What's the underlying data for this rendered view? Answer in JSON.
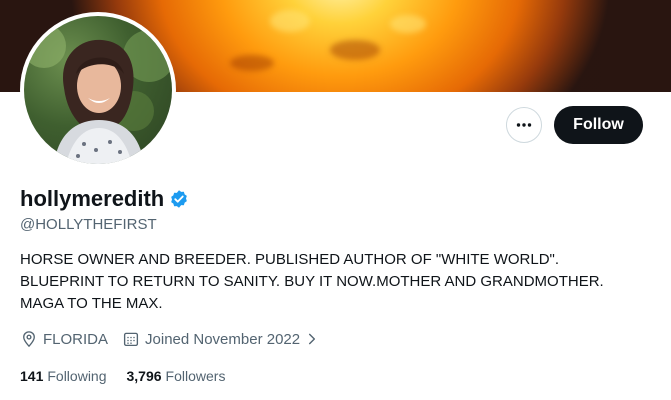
{
  "profile": {
    "display_name": "hollymeredith",
    "handle": "@HOLLYTHEFIRST",
    "verified": true,
    "bio_lines": [
      "HORSE OWNER AND BREEDER. PUBLISHED AUTHOR OF \"WHITE WORLD\".",
      "BLUEPRINT TO RETURN TO SANITY. BUY IT NOW.MOTHER AND GRANDMOTHER.",
      "MAGA TO THE MAX."
    ],
    "location": "FLORIDA",
    "joined": "Joined November 2022"
  },
  "actions": {
    "follow_label": "Follow",
    "more_icon": "ellipsis-icon"
  },
  "stats": {
    "following_count": "141",
    "following_label": "Following",
    "followers_count": "3,796",
    "followers_label": "Followers"
  },
  "colors": {
    "verified_badge": "#1d9bf0",
    "follow_button_bg": "#0f1419",
    "secondary_text": "#536471"
  }
}
